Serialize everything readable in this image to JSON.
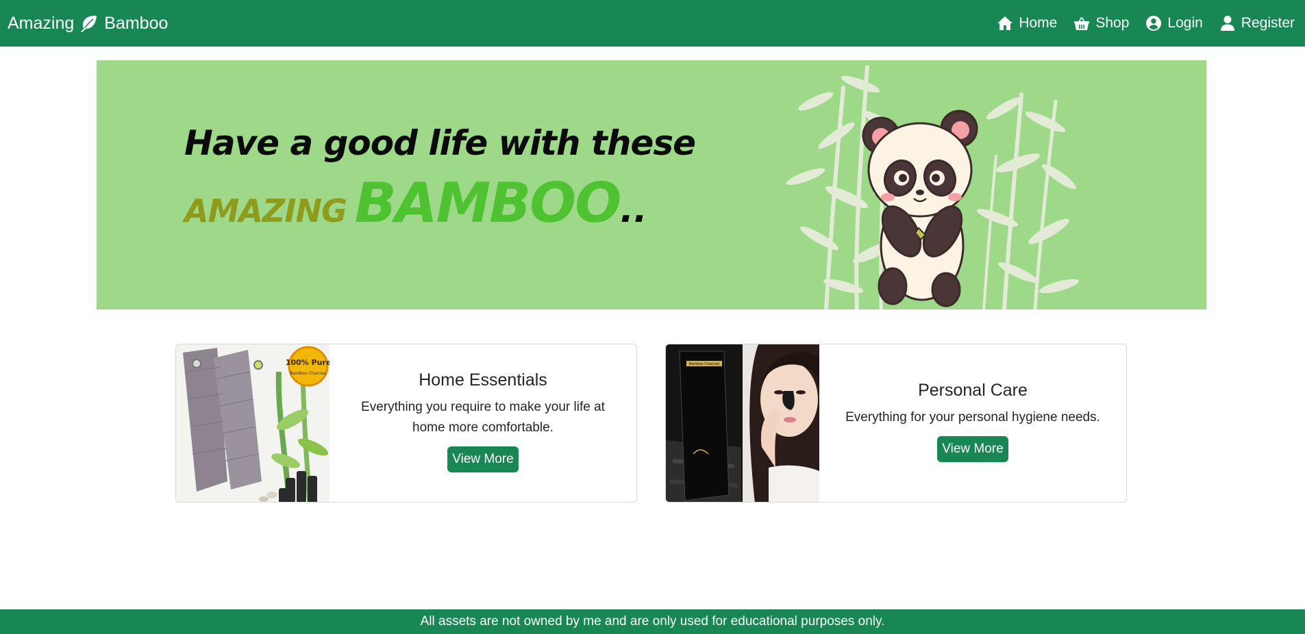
{
  "brand": {
    "name_left": "Amazing",
    "name_right": "Bamboo",
    "icon": "leaf-icon"
  },
  "nav": {
    "items": [
      {
        "label": "Home",
        "icon": "home-icon"
      },
      {
        "label": "Shop",
        "icon": "basket-icon"
      },
      {
        "label": "Login",
        "icon": "user-circle-icon"
      },
      {
        "label": "Register",
        "icon": "user-icon"
      }
    ]
  },
  "banner": {
    "line1": "Have a good life with these",
    "word_amazing": "AMAZING",
    "word_bamboo": "BAMBOO",
    "dots": ".."
  },
  "cards": [
    {
      "title": "Home Essentials",
      "text": "Everything you require to make your life at home more comfortable.",
      "button": "View More",
      "image_badge": "100% Pure"
    },
    {
      "title": "Personal Care",
      "text": "Everything for your personal hygiene needs.",
      "button": "View More"
    }
  ],
  "footer": {
    "text": "All assets are not owned by me and are only used for educational purposes only."
  },
  "colors": {
    "primary": "#198754",
    "banner_bg": "#9dd988",
    "bamboo_green": "#4ec231",
    "amazing_olive": "#8f9b1a"
  }
}
